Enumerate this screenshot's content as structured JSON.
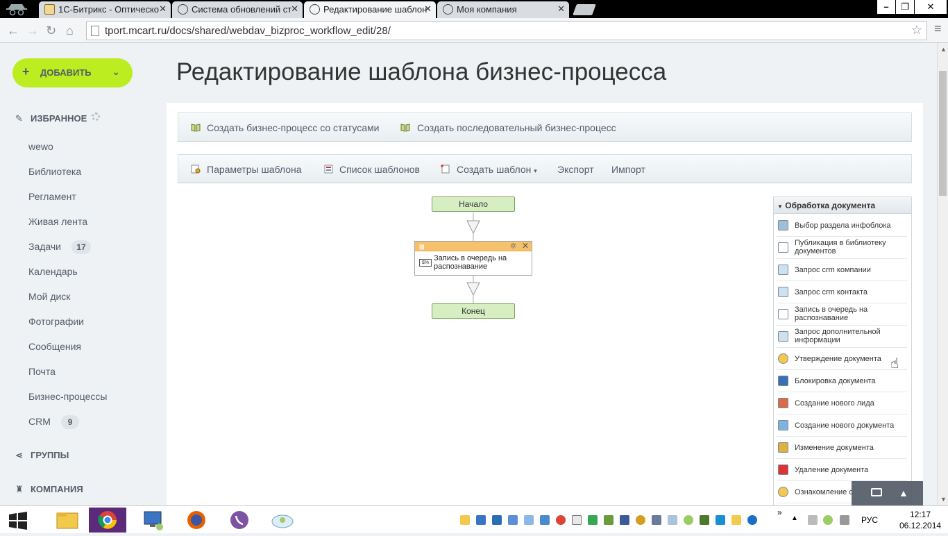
{
  "browser": {
    "tabs": [
      {
        "label": "1С-Битрикс - Оптическо"
      },
      {
        "label": "Система обновлений ст"
      },
      {
        "label": "Редактирование шаблон"
      },
      {
        "label": "Моя компания"
      }
    ],
    "close_glyph": "✕",
    "url": "tport.mcart.ru/docs/shared/webdav_bizproc_workflow_edit/28/"
  },
  "sidebar": {
    "add_button": "ДОБАВИТЬ",
    "favorites_title": "ИЗБРАННОЕ",
    "items": [
      {
        "label": "wewo"
      },
      {
        "label": "Библиотека"
      },
      {
        "label": "Регламент"
      },
      {
        "label": "Живая лента"
      },
      {
        "label": "Задачи",
        "badge": "17"
      },
      {
        "label": "Календарь"
      },
      {
        "label": "Мой диск"
      },
      {
        "label": "Фотографии"
      },
      {
        "label": "Сообщения"
      },
      {
        "label": "Почта"
      },
      {
        "label": "Бизнес-процессы"
      },
      {
        "label": "CRM",
        "badge": "9"
      }
    ],
    "groups_title": "ГРУППЫ",
    "company_title": "КОМПАНИЯ"
  },
  "page": {
    "title": "Редактирование шаблона бизнес-процесса"
  },
  "toolbar1": {
    "create_status": "Создать бизнес-процесс со статусами",
    "create_sequential": "Создать последовательный бизнес-процесс"
  },
  "toolbar2": {
    "template_params": "Параметры шаблона",
    "template_list": "Список шаблонов",
    "create_template": "Создать шаблон",
    "export": "Экспорт",
    "import": "Импорт"
  },
  "designer": {
    "start": "Начало",
    "activity": "Запись в очередь на распознавание",
    "end": "Конец"
  },
  "activity_panel": {
    "title": "Обработка документа",
    "items": [
      {
        "label": "Выбор раздела инфоблока"
      },
      {
        "label": "Публикация в библиотеку документов"
      },
      {
        "label": "Запрос crm компании"
      },
      {
        "label": "Запрос crm контакта"
      },
      {
        "label": "Запись в очередь на распознавание"
      },
      {
        "label": "Запрос дополнительной информации"
      },
      {
        "label": "Утверждение документа"
      },
      {
        "label": "Блокировка документа"
      },
      {
        "label": "Создание нового лида"
      },
      {
        "label": "Создание нового документа"
      },
      {
        "label": "Изменение документа"
      },
      {
        "label": "Удаление документа"
      },
      {
        "label": "Ознакомление с"
      }
    ]
  },
  "taskbar": {
    "language": "РУС",
    "time": "12:17",
    "date": "06.12.2014"
  },
  "colors": {
    "add_button": "#bbed21",
    "start_block": "#d7eec3",
    "activity_header": "#f5c26b",
    "sidebar_text": "#535c69"
  }
}
